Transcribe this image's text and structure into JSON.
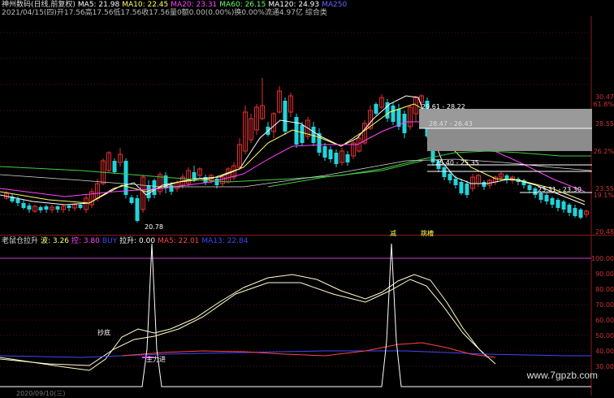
{
  "header": {
    "line1": [
      {
        "text": "神州数码(日线,前复权)",
        "color": "#dddddd"
      },
      {
        "text": "MA5: 21.98",
        "color": "#ffffff"
      },
      {
        "text": "MA10: 22.45",
        "color": "#ffff66"
      },
      {
        "text": "MA20: 23.31",
        "color": "#ff44ff"
      },
      {
        "text": "MA60: 26.15",
        "color": "#66ff66"
      },
      {
        "text": "MA120: 24.93",
        "color": "#ffffff"
      },
      {
        "text": "MA250",
        "color": "#6666ff"
      }
    ],
    "line2": "2021/04/15(四)开17.56高17.56低17.56收17.56量0额0.00(0.00%)换0.00%流通4.97亿 综合类",
    "indicator": [
      {
        "text": "老鼠仓拉升",
        "color": "#dddddd"
      },
      {
        "text": "波: 3.26",
        "color": "#ffff66"
      },
      {
        "text": "控: 3.80",
        "color": "#ff44ff"
      },
      {
        "text": "BUY",
        "color": "#4444ff"
      },
      {
        "text": "拉升: 0.00",
        "color": "#ffffff"
      },
      {
        "text": "MA5: 22.01",
        "color": "#ff4444"
      },
      {
        "text": "MA13: 22.84",
        "color": "#4444ff"
      }
    ]
  },
  "price_axis": [
    "30.47",
    "61.8%",
    "28.55",
    "26.2%",
    "23.55",
    "19.1%",
    "20.48"
  ],
  "indicator_axis": [
    "100.00",
    "90.00",
    "80.00",
    "70.00",
    "60.00",
    "50.00",
    "40.00",
    "30.00"
  ],
  "annotations": {
    "low_label": "20.78",
    "box1": "29.61 - 28.22",
    "box1b": "28.47 - 26.43",
    "box2": "25.40 - 25.35",
    "box3": "23.31 - 23.30",
    "signal1": "减",
    "signal2": "跳槽",
    "chaodi": "抄底",
    "zhuli": "主力进",
    "date": "2020/09/10(三)"
  },
  "watermark": "www.7gpzb.com"
}
